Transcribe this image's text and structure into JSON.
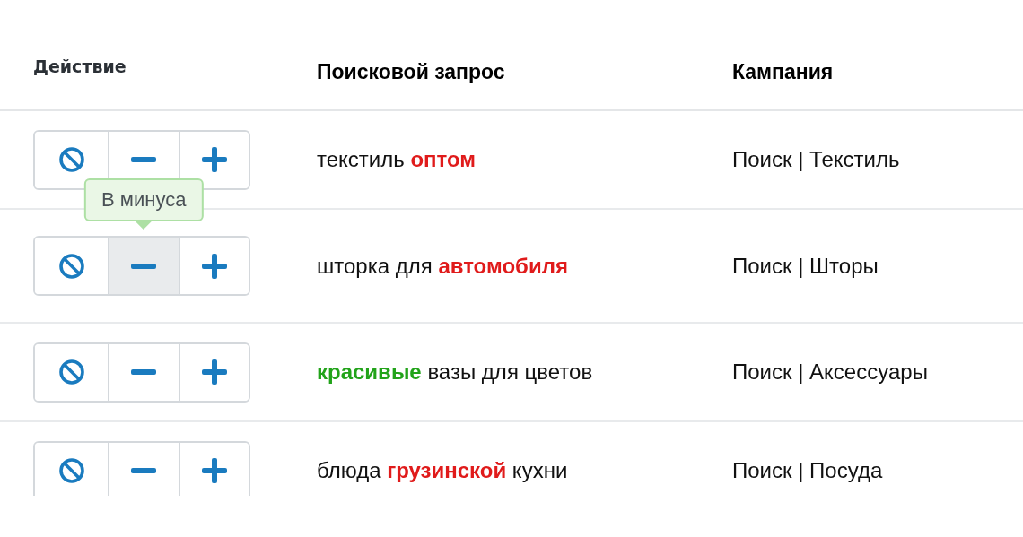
{
  "table": {
    "columns": [
      "Действие",
      "Поисковой запрос",
      "Кампания"
    ],
    "rows": [
      {
        "actions": [
          {
            "kind": "block",
            "selected": false
          },
          {
            "kind": "minus",
            "selected": false
          },
          {
            "kind": "plus",
            "selected": false
          }
        ],
        "query": [
          {
            "text": "текстиль ",
            "kind": "plain"
          },
          {
            "text": "оптом",
            "kind": "minus"
          }
        ],
        "campaign": "Поиск | Текстиль"
      },
      {
        "actions": [
          {
            "kind": "block",
            "selected": false
          },
          {
            "kind": "minus",
            "selected": true,
            "tooltip": "В минуса"
          },
          {
            "kind": "plus",
            "selected": false
          }
        ],
        "query": [
          {
            "text": "шторка для ",
            "kind": "plain"
          },
          {
            "text": "автомобиля",
            "kind": "minus"
          }
        ],
        "campaign": "Поиск | Шторы"
      },
      {
        "actions": [
          {
            "kind": "block",
            "selected": false
          },
          {
            "kind": "minus",
            "selected": false
          },
          {
            "kind": "plus",
            "selected": false
          }
        ],
        "query": [
          {
            "text": "красивые",
            "kind": "plus"
          },
          {
            "text": " вазы для цветов",
            "kind": "plain"
          }
        ],
        "campaign": "Поиск | Аксессуары"
      },
      {
        "actions": [
          {
            "kind": "block",
            "selected": false
          },
          {
            "kind": "minus",
            "selected": false
          },
          {
            "kind": "plus",
            "selected": false
          }
        ],
        "query": [
          {
            "text": "блюда ",
            "kind": "plain"
          },
          {
            "text": "грузинской",
            "kind": "minus"
          },
          {
            "text": " кухни",
            "kind": "plain"
          }
        ],
        "campaign": "Поиск | Посуда"
      }
    ]
  }
}
